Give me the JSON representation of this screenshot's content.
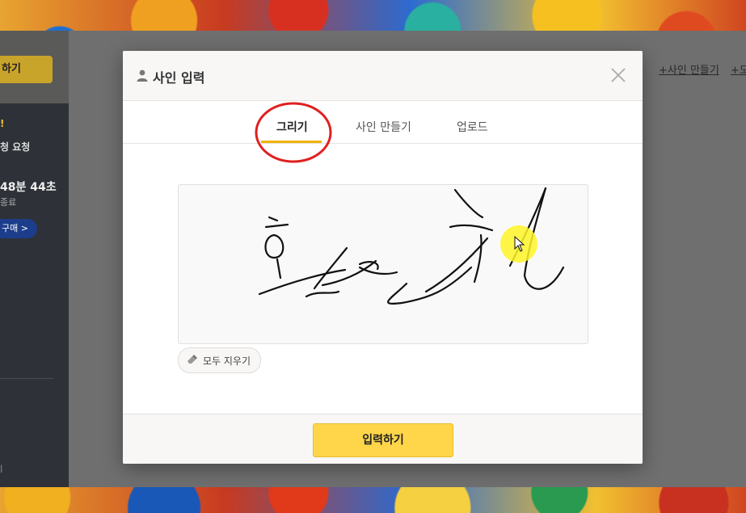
{
  "background": {
    "left_panel": {
      "login_label": "하기",
      "notice_mark": "!",
      "request_label": "청 요청",
      "timer": "48분 44초",
      "end_label": "종료",
      "buy_label": "구매 >",
      "footer_mark": "l"
    },
    "top_links": [
      "+사인 만들기",
      "+도"
    ]
  },
  "modal": {
    "title": "사인 입력",
    "tabs": [
      "그리기",
      "사인 만들기",
      "업로드"
    ],
    "active_tab": "그리기",
    "clear_label": "모두 지우기",
    "submit_label": "입력하기"
  },
  "colors": {
    "accent": "#f0b400",
    "submit_bg": "#ffd54a",
    "annotation": "#e02020"
  },
  "icons": {
    "title_icon": "user-icon",
    "close_icon": "close-icon",
    "clear_icon": "eraser-icon"
  }
}
